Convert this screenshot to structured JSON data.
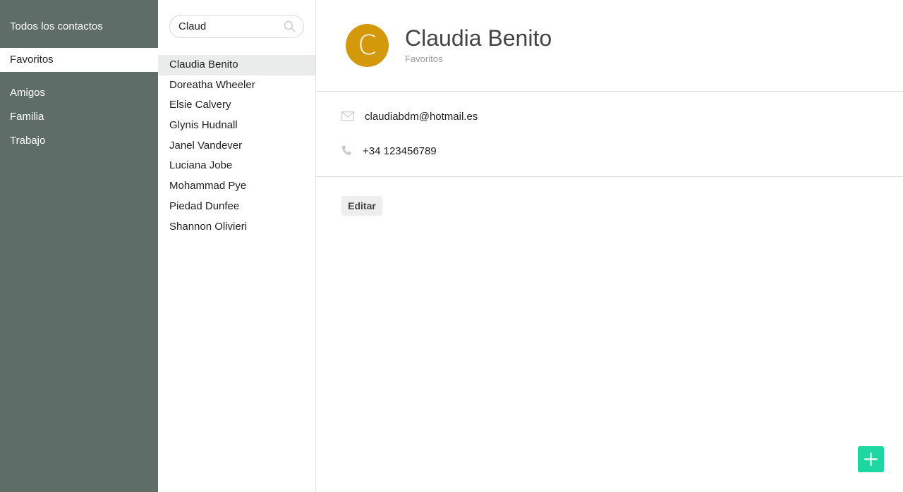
{
  "sidebar": {
    "all_contacts": "Todos los contactos",
    "groups": [
      {
        "label": "Favoritos",
        "active": true
      },
      {
        "label": "Amigos",
        "active": false
      },
      {
        "label": "Familia",
        "active": false
      },
      {
        "label": "Trabajo",
        "active": false
      }
    ]
  },
  "search": {
    "value": "Claud",
    "icon": "search-icon"
  },
  "contacts": [
    "Claudia Benito",
    "Doreatha Wheeler",
    "Elsie Calvery",
    "Glynis Hudnall",
    "Janel Vandever",
    "Luciana Jobe",
    "Mohammad Pye",
    "Piedad Dunfee",
    "Shannon Olivieri"
  ],
  "selected_contact": {
    "initial": "C",
    "name": "Claudia Benito",
    "group": "Favoritos",
    "email": "claudiabdm@hotmail.es",
    "phone": "+34 123456789",
    "avatar_color": "#d4990a"
  },
  "actions": {
    "edit_label": "Editar",
    "add_icon": "plus-icon"
  },
  "colors": {
    "sidebar_bg": "#5e6d68",
    "accent": "#1ed6a2",
    "selected_row": "#e9eceb"
  }
}
